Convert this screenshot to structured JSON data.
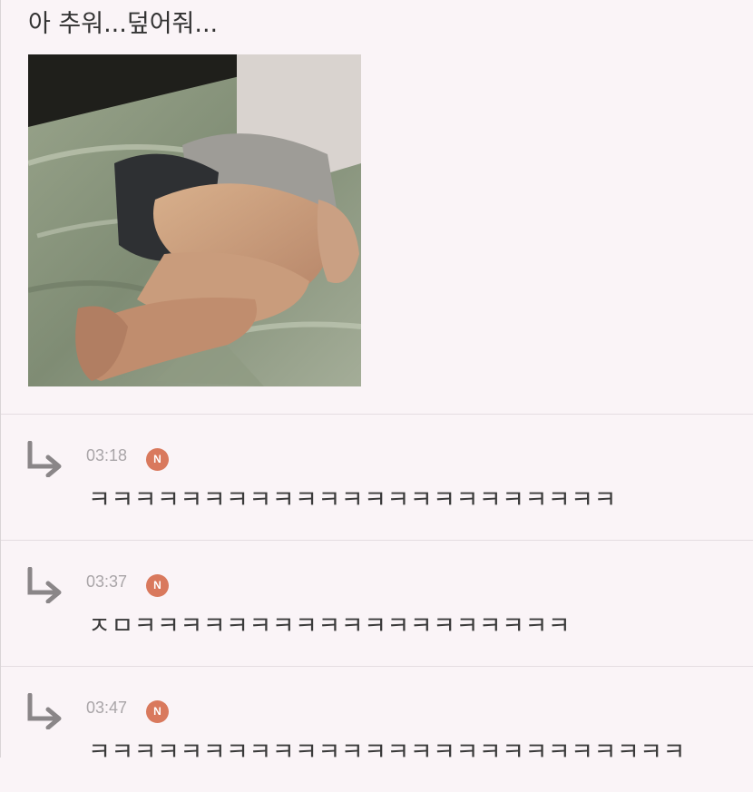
{
  "post": {
    "text": "아 추워...덮어줘...",
    "image_alt": "photo of a person lying curled up on a bed with green sheets"
  },
  "comments": [
    {
      "time": "03:18",
      "badge": "N",
      "text": "ㅋㅋㅋㅋㅋㅋㅋㅋㅋㅋㅋㅋㅋㅋㅋㅋㅋㅋㅋㅋㅋㅋㅋ"
    },
    {
      "time": "03:37",
      "badge": "N",
      "text": "ㅈㅁㅋㅋㅋㅋㅋㅋㅋㅋㅋㅋㅋㅋㅋㅋㅋㅋㅋㅋㅋ"
    },
    {
      "time": "03:47",
      "badge": "N",
      "text": "ㅋㅋㅋㅋㅋㅋㅋㅋㅋㅋㅋㅋㅋㅋㅋㅋㅋㅋㅋㅋㅋㅋㅋㅋㅋㅋ"
    }
  ],
  "colors": {
    "background": "#faf4f7",
    "badge": "#d9795d",
    "timestamp": "#a9a5a8",
    "reply_icon": "#8a8688"
  },
  "icons": {
    "reply": "reply-arrow-icon",
    "new": "new-badge-icon"
  }
}
